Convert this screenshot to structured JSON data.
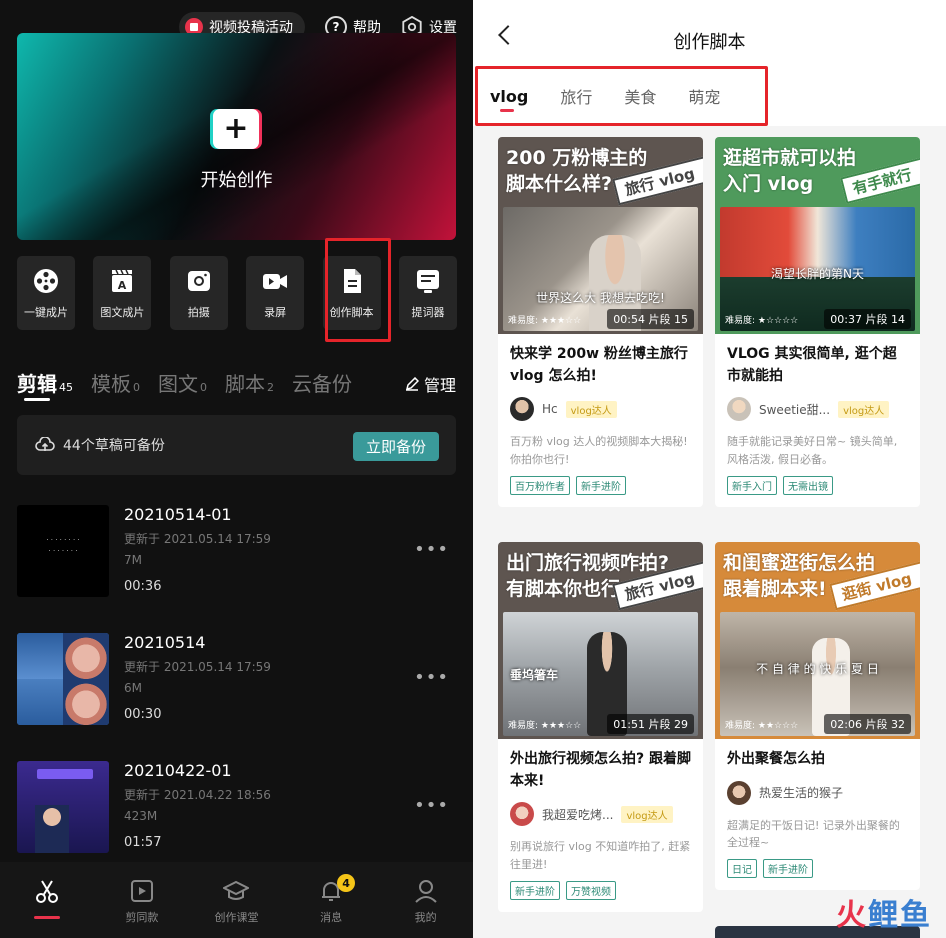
{
  "left": {
    "topbar": {
      "promo": "视频投稿活动",
      "help": "帮助",
      "settings": "设置"
    },
    "hero": {
      "label": "开始创作"
    },
    "tools": [
      {
        "icon": "film-reel-icon",
        "label": "一键成片"
      },
      {
        "icon": "text-clapper-icon",
        "label": "图文成片"
      },
      {
        "icon": "camera-icon",
        "label": "拍摄"
      },
      {
        "icon": "video-camera-icon",
        "label": "录屏"
      },
      {
        "icon": "script-document-icon",
        "label": "创作脚本"
      },
      {
        "icon": "teleprompter-icon",
        "label": "提词器"
      }
    ],
    "tabs": [
      {
        "label": "剪辑",
        "count": "45",
        "active": true
      },
      {
        "label": "模板",
        "count": "0"
      },
      {
        "label": "图文",
        "count": "0"
      },
      {
        "label": "脚本",
        "count": "2"
      },
      {
        "label": "云备份",
        "count": ""
      }
    ],
    "manage": "管理",
    "backup": {
      "text": "44个草稿可备份",
      "button": "立即备份"
    },
    "drafts": [
      {
        "name": "20210514-01",
        "updated": "更新于 2021.05.14 17:59",
        "size": "7M",
        "duration": "00:36"
      },
      {
        "name": "20210514",
        "updated": "更新于 2021.05.14 17:59",
        "size": "6M",
        "duration": "00:30"
      },
      {
        "name": "20210422-01",
        "updated": "更新于 2021.04.22 18:56",
        "size": "423M",
        "duration": "01:57"
      }
    ],
    "nav": [
      {
        "icon": "scissors-icon",
        "label": "剪辑",
        "active": true
      },
      {
        "icon": "template-play-icon",
        "label": "剪同款"
      },
      {
        "icon": "graduation-cap-icon",
        "label": "创作课堂"
      },
      {
        "icon": "bell-icon",
        "label": "消息",
        "badge": "4"
      },
      {
        "icon": "user-icon",
        "label": "我的"
      }
    ]
  },
  "right": {
    "title": "创作脚本",
    "tabs": [
      {
        "label": "vlog",
        "active": true
      },
      {
        "label": "旅行"
      },
      {
        "label": "美食"
      },
      {
        "label": "萌宠"
      }
    ],
    "cards": [
      {
        "cover_title_1": "200 万粉博主的",
        "cover_title_2": "脚本什么样?",
        "stamp": "旅行 vlog",
        "subtitle": "世界这么大 我想去吃吃!",
        "difficulty": "难易度: ★★★☆☆",
        "duration": "00:54 片段 15",
        "headline": "快来学 200w 粉丝博主旅行 vlog 怎么拍!",
        "author": "Hc",
        "author_tag": "vlog达人",
        "desc": "百万粉 vlog 达人的视频脚本大揭秘! 你拍你也行!",
        "tags": [
          "百万粉作者",
          "新手进阶"
        ],
        "band_color": "#5e5550"
      },
      {
        "cover_title_1": "逛超市就可以拍",
        "cover_title_2": "入门 vlog",
        "stamp": "有手就行",
        "subtitle": "渴望长胖的第N天",
        "difficulty": "难易度: ★☆☆☆☆",
        "duration": "00:37 片段 14",
        "headline": "VLOG 其实很简单, 逛个超市就能拍",
        "author": "Sweetie甜...",
        "author_tag": "vlog达人",
        "desc": "随手就能记录美好日常~ 镜头简单, 风格活泼, 假日必备。",
        "tags": [
          "新手入门",
          "无需出镜"
        ],
        "band_color": "#4f9a5c"
      },
      {
        "cover_title_1": "出门旅行视频咋拍?",
        "cover_title_2": "有脚本你也行",
        "stamp": "旅行 vlog",
        "subtitle": "垂坞箸车",
        "difficulty": "难易度: ★★★☆☆",
        "duration": "01:51 片段 29",
        "headline": "外出旅行视频怎么拍? 跟着脚本来!",
        "author": "我超爱吃烤...",
        "author_tag": "vlog达人",
        "desc": "别再说旅行 vlog 不知道咋拍了, 赶紧往里进!",
        "tags": [
          "新手进阶",
          "万赞视频"
        ],
        "band_color": "#5e5550"
      },
      {
        "cover_title_1": "和闺蜜逛街怎么拍",
        "cover_title_2": "跟着脚本来!",
        "stamp": "逛街 vlog",
        "subtitle": "不 自 律 的 快 乐 夏 日",
        "difficulty": "难易度: ★★☆☆☆",
        "duration": "02:06 片段 32",
        "headline": "外出聚餐怎么拍",
        "author": "热爱生活的猴子",
        "author_tag": "",
        "desc": "超满足的干饭日记! 记录外出聚餐的全过程~",
        "tags": [
          "日记",
          "新手进阶"
        ],
        "band_color": "#d68a3a"
      }
    ]
  },
  "watermark": "火鲤鱼"
}
